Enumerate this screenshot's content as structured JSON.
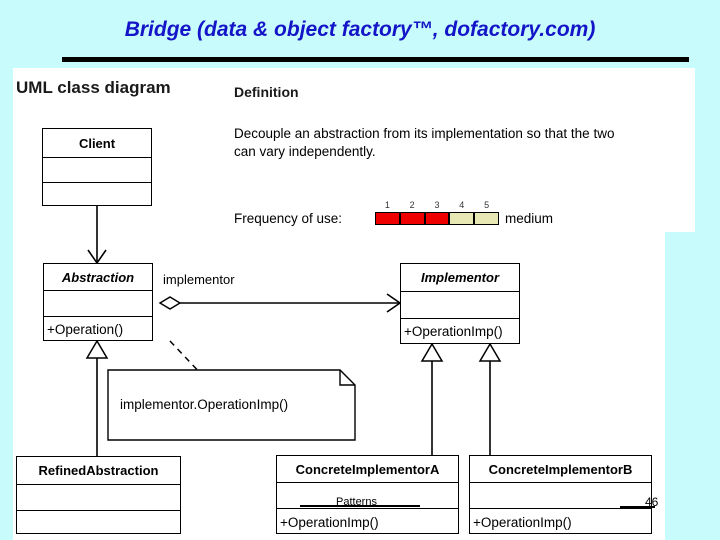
{
  "slide": {
    "title": "Bridge (data & object factory™, dofactory.com)",
    "background_color": "#c8fbfb",
    "title_color": "#1414c8",
    "page_number": "46",
    "footer_label": "Patterns"
  },
  "sections": {
    "diagram_heading": "UML class diagram",
    "definition_heading": "Definition",
    "definition_line1": "Decouple an abstraction from its implementation so that the two",
    "definition_line2": "can vary independently."
  },
  "frequency": {
    "label": "Frequency of use:",
    "rating_text": "medium",
    "scale": [
      "1",
      "2",
      "3",
      "4",
      "5"
    ],
    "filled": 3,
    "total": 5,
    "filled_color": "#ee0000",
    "empty_color": "#e8e8b4"
  },
  "classes": [
    {
      "id": "client",
      "name": "Client",
      "abstract": false,
      "attributes": "",
      "operations": ""
    },
    {
      "id": "abstraction",
      "name": "Abstraction",
      "abstract": true,
      "attributes": "",
      "operations": "+Operation()"
    },
    {
      "id": "implementor",
      "name": "Implementor",
      "abstract": true,
      "attributes": "",
      "operations": "+OperationImp()"
    },
    {
      "id": "refined-abstraction",
      "name": "RefinedAbstraction",
      "abstract": false,
      "attributes": "",
      "operations": ""
    },
    {
      "id": "concrete-implementor-a",
      "name": "ConcreteImplementorA",
      "abstract": false,
      "attributes": "",
      "operations": "+OperationImp()"
    },
    {
      "id": "concrete-implementor-b",
      "name": "ConcreteImplementorB",
      "abstract": false,
      "attributes": "",
      "operations": "+OperationImp()"
    }
  ],
  "relations": {
    "association_role": "implementor",
    "note_text": "implementor.OperationImp()"
  }
}
